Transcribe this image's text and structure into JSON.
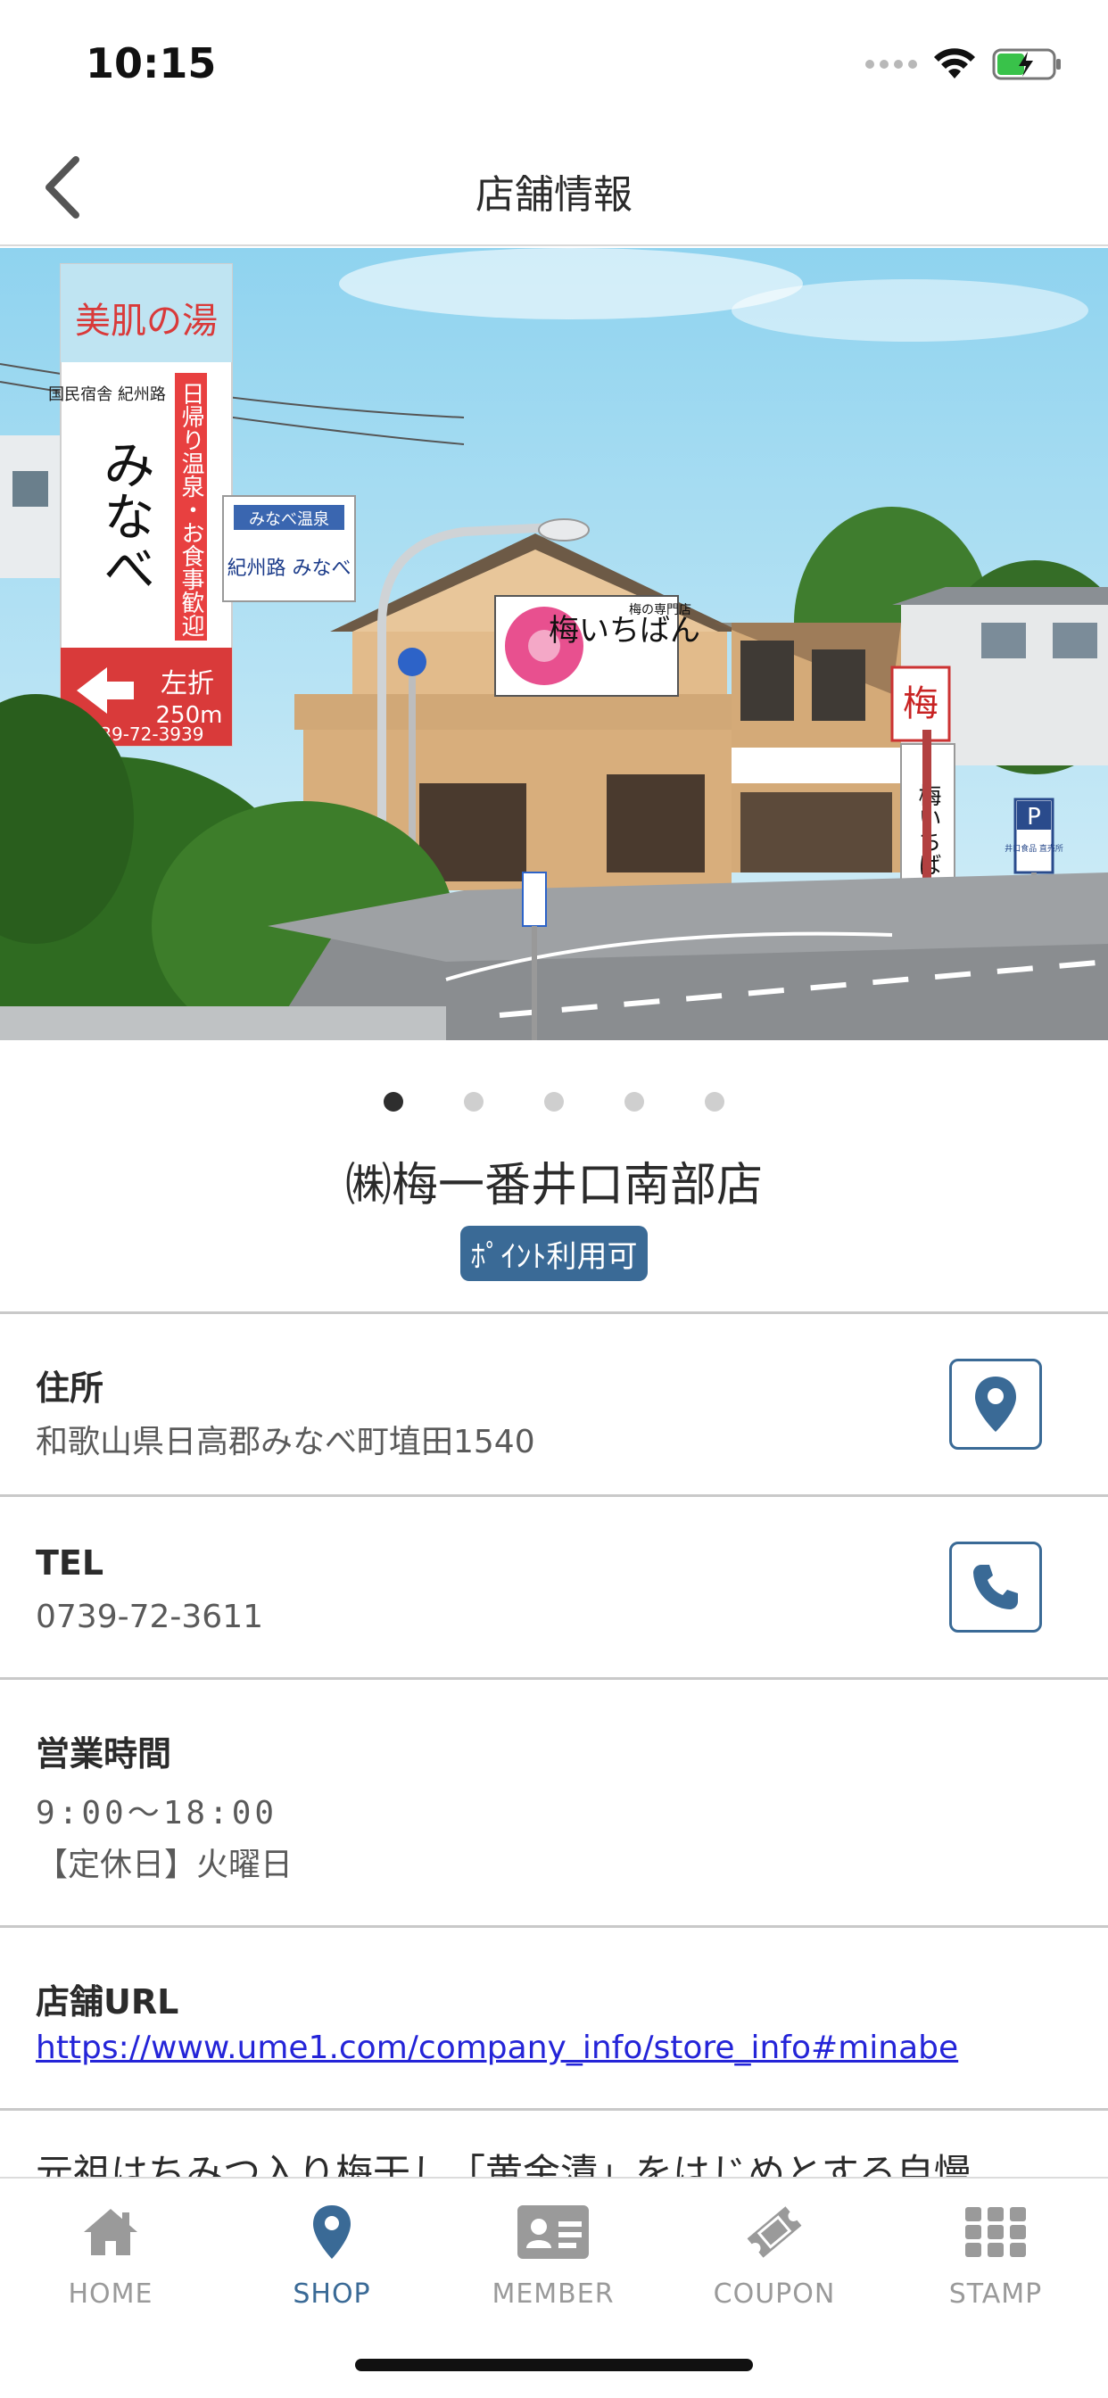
{
  "status_bar": {
    "time": "10:15",
    "battery_color": "#39c24a"
  },
  "nav": {
    "title": "店舗情報",
    "back_icon": "chevron-left-icon"
  },
  "hero": {
    "signs": {
      "tall_sign_top": "美肌の湯",
      "tall_sign_sub": "国民宿舎 紀州路",
      "tall_sign_main": "みなべ",
      "tall_sign_side": "日帰り温泉・お食事歓迎",
      "turn_text": "左折",
      "turn_distance": "250m",
      "phone_partial": "739-72-3939",
      "small_sign_top": "みなべ温泉",
      "small_sign_main": "紀州路 みなべ",
      "building_sign_tag": "梅の専門店",
      "building_sign_main": "梅いちばん",
      "ume_sign": "梅",
      "ume_vertical": "梅いちばん",
      "parking": "P",
      "parking_sub": "井口食品 直売所"
    }
  },
  "pager": {
    "count": 5,
    "active_index": 0
  },
  "shop": {
    "name": "㈱梅一番井口南部店",
    "badge": "ﾎﾟｲﾝﾄ利用可"
  },
  "address": {
    "label": "住所",
    "value": "和歌山県日高郡みなべ町埴田1540",
    "icon": "map-pin-icon"
  },
  "tel": {
    "label": "TEL",
    "value": "0739-72-3611",
    "icon": "phone-icon"
  },
  "hours": {
    "label": "営業時間",
    "time": "9:00〜18:00",
    "holiday": "【定休日】火曜日"
  },
  "url": {
    "label": "店舗URL",
    "value": "https://www.ume1.com/company_info/store_info#minabe"
  },
  "description": {
    "partial": "元祖はちみつ入り梅干し「黄金漬」をはじめとする自慢"
  },
  "tabs": [
    {
      "label": "HOME",
      "icon": "home-icon",
      "active": false
    },
    {
      "label": "SHOP",
      "icon": "map-pin-icon",
      "active": true
    },
    {
      "label": "MEMBER",
      "icon": "member-card-icon",
      "active": false
    },
    {
      "label": "COUPON",
      "icon": "coupon-ticket-icon",
      "active": false
    },
    {
      "label": "STAMP",
      "icon": "stamp-grid-icon",
      "active": false
    }
  ],
  "colors": {
    "accent": "#3a6a96",
    "link": "#2424d8",
    "inactive_tab": "#9a9a9a"
  }
}
